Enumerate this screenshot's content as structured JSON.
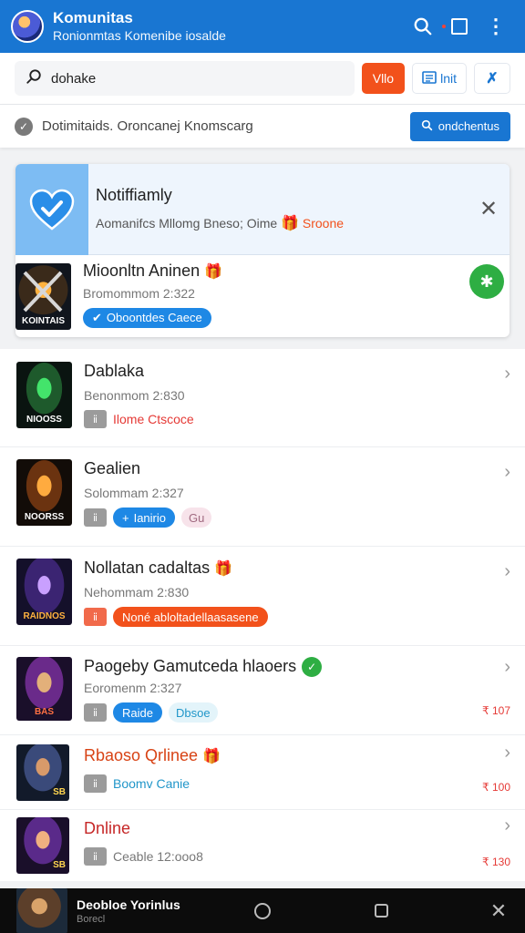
{
  "header": {
    "title": "Komunitas",
    "subtitle": "Ronionmtas Komenibe iosalde",
    "icons": [
      "search-icon",
      "window-icon",
      "more-icon"
    ]
  },
  "search": {
    "value": "dohake",
    "chip_orange": "Vllo",
    "chip_outline": "lnit"
  },
  "info": {
    "text": "Dotimitaids. Oroncanej Knomscarg",
    "button": "ondchentus"
  },
  "notification": {
    "title": "Notiffiamly",
    "sub_prefix": "Aomanifcs Mllomg Bneso; Oime",
    "sub_highlight": "Sroone"
  },
  "featured": {
    "name": "Mioonltn Aninen",
    "meta": "Bromommom 2:322",
    "thumb_caption": "KOINTAIS",
    "tag": "Oboontdes Caece"
  },
  "items": [
    {
      "name": "Dablaka",
      "meta": "Benonmom 2:830",
      "caption": "NIOOSS",
      "tag_text": "Ilome Ctscoce"
    },
    {
      "name": "Gealien",
      "meta": "Solommam 2:327",
      "caption": "NOORSS",
      "pill": "Ianirio",
      "extra": "Gu"
    },
    {
      "name": "Nollatan cadaltas",
      "meta": "Nehommam 2:830",
      "caption": "RAIDNOS",
      "pill": "Noné abloltadellaasasene"
    },
    {
      "name": "Paogeby Gamutceda hlaoers",
      "meta": "Eoromenm 2:327",
      "caption": "BAS",
      "pill": "Raide",
      "extra": "Dbsoe",
      "right": "₹ 107"
    },
    {
      "name": "Rbaoso Qrlinee",
      "meta": "",
      "caption": "SB",
      "tag_text": "Boomv Canie",
      "right": "₹ 100"
    },
    {
      "name": "Dnline",
      "meta": "",
      "caption": "SB",
      "tag_text": "Ceable 12:ooo8",
      "right": "₹ 130"
    }
  ],
  "bottom": {
    "title": "Deobloe Yorinlus",
    "subtitle": "Borecl"
  },
  "colors": {
    "primary": "#1976d2",
    "accent_orange": "#f2511b",
    "green": "#2eae43"
  }
}
